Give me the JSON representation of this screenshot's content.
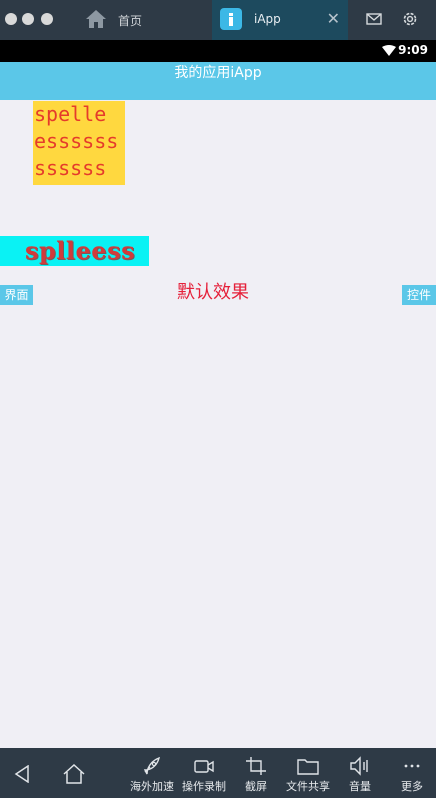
{
  "titlebar": {
    "tabs": [
      {
        "label": "首页",
        "icon": "home-icon"
      },
      {
        "label": "iApp",
        "icon": "iapp-icon"
      }
    ],
    "close_glyph": "✕"
  },
  "statusbar": {
    "time": "9:09"
  },
  "appbar": {
    "title": "我的应用iApp"
  },
  "content": {
    "yellow_lines": [
      "spelle",
      "essssss",
      "ssssss"
    ],
    "cyan_text": "splleess",
    "left_button": "界面",
    "center_text": "默认效果",
    "right_button": "控件"
  },
  "bottombar": {
    "items": [
      {
        "label": "海外加速",
        "icon": "rocket-icon"
      },
      {
        "label": "操作录制",
        "icon": "video-icon"
      },
      {
        "label": "截屏",
        "icon": "crop-icon"
      },
      {
        "label": "文件共享",
        "icon": "folder-icon"
      },
      {
        "label": "音量",
        "icon": "speaker-icon"
      },
      {
        "label": "更多",
        "icon": "more-icon"
      }
    ]
  },
  "colors": {
    "titlebar": "#2e3a46",
    "accent": "#5bc7e8",
    "yellow": "#ffd83f",
    "cyan": "#0af2f4",
    "red_text": "#e5203a"
  }
}
